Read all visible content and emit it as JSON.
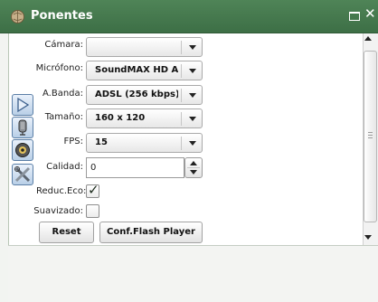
{
  "window": {
    "title": "Ponentes",
    "icons": {
      "app": "speaker-globe-icon",
      "maximize": "maximize-icon",
      "close": "close-icon"
    }
  },
  "toolbar_icons": [
    "play-icon",
    "microphone-icon",
    "webcam-icon",
    "settings-tools-icon"
  ],
  "form": {
    "camera": {
      "label": "Cámara:",
      "value": ""
    },
    "microphone": {
      "label": "Micrófono:",
      "value": "SoundMAX HD Au"
    },
    "bandwidth": {
      "label": "A.Banda:",
      "value": "ADSL (256 kbps)"
    },
    "size": {
      "label": "Tamaño:",
      "value": "160 x 120"
    },
    "fps": {
      "label": "FPS:",
      "value": "15"
    },
    "quality": {
      "label": "Calidad:",
      "value": "0"
    },
    "echo_reduction": {
      "label": "Reduc.Eco:",
      "checked": true,
      "mark": "✓"
    },
    "smoothing": {
      "label": "Suavizado:",
      "checked": false
    }
  },
  "buttons": {
    "reset": "Reset",
    "flash_config": "Conf.Flash Player"
  }
}
